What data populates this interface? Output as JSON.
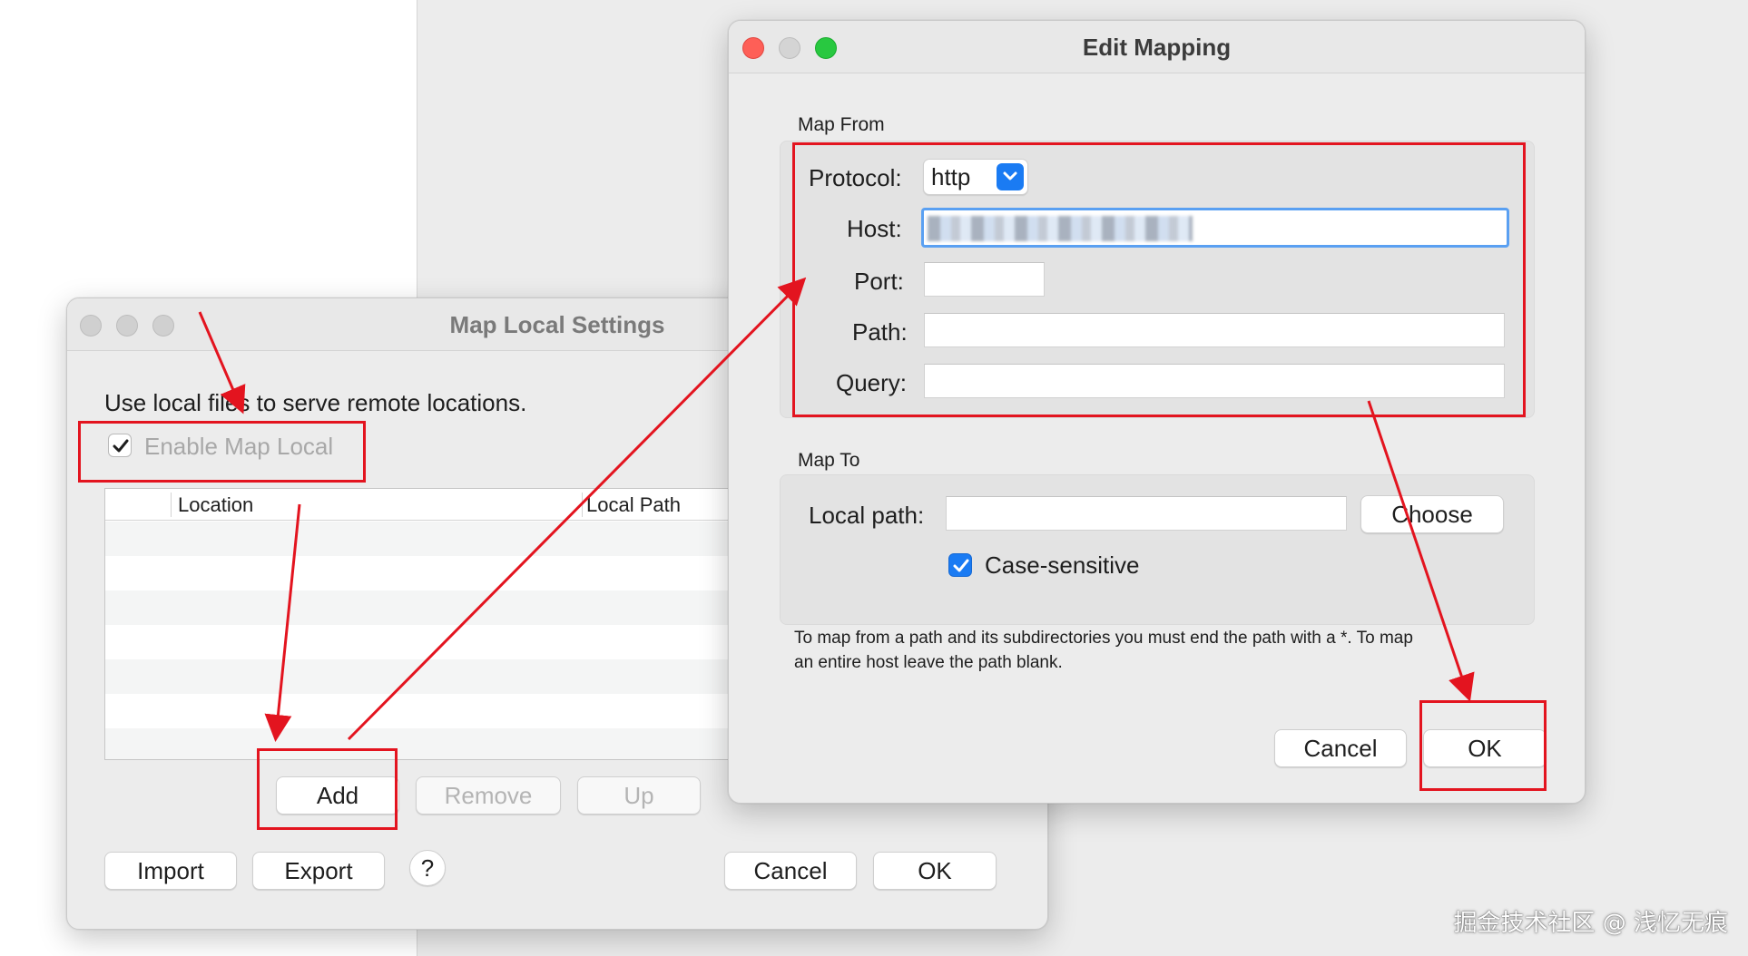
{
  "map_local_window": {
    "title": "Map Local Settings",
    "description": "Use local files to serve remote locations.",
    "enable_label": "Enable Map Local",
    "enable_checked": true,
    "table": {
      "columns": [
        "Location",
        "Local Path"
      ],
      "rows": []
    },
    "buttons": {
      "add": "Add",
      "remove": "Remove",
      "up": "Up",
      "import": "Import",
      "export": "Export",
      "help": "?",
      "cancel": "Cancel",
      "ok": "OK"
    }
  },
  "edit_mapping_window": {
    "title": "Edit Mapping",
    "map_from": {
      "section_label": "Map From",
      "protocol_label": "Protocol:",
      "protocol_value": "http",
      "host_label": "Host:",
      "host_value": "",
      "port_label": "Port:",
      "port_value": "",
      "path_label": "Path:",
      "path_value": "",
      "query_label": "Query:",
      "query_value": ""
    },
    "map_to": {
      "section_label": "Map To",
      "local_path_label": "Local path:",
      "local_path_value": "",
      "choose_button": "Choose",
      "case_sensitive_label": "Case-sensitive",
      "case_sensitive_checked": true
    },
    "hint_line1": "To map from a path and its subdirectories you must end the path with a *. To map",
    "hint_line2": "an entire host leave the path blank.",
    "buttons": {
      "cancel": "Cancel",
      "ok": "OK"
    }
  },
  "watermark": "掘金技术社区 @ 浅忆无痕",
  "colors": {
    "accent_blue": "#1a7bf3",
    "annotation_red": "#e3141f",
    "window_bg": "#ececec"
  }
}
